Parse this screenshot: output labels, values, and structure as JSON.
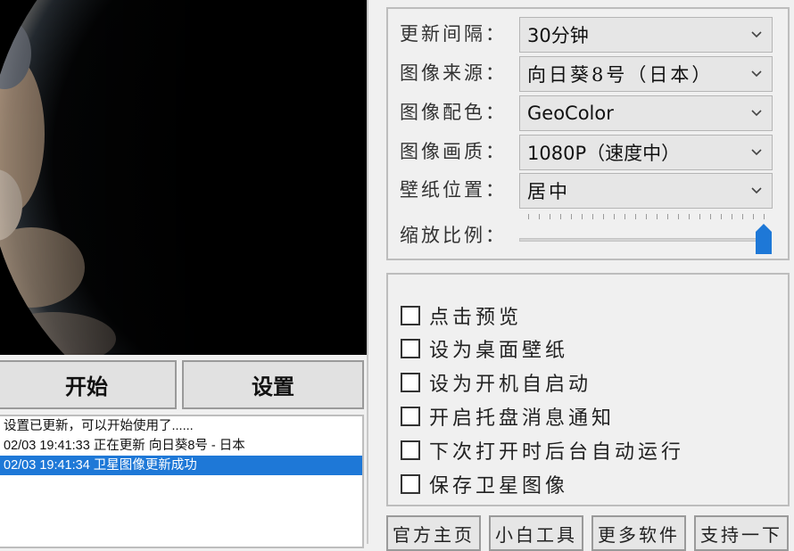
{
  "preview": {
    "icon": "earth-satellite-image"
  },
  "actions": {
    "start_label": "开始",
    "settings_label": "设置"
  },
  "log": {
    "lines": [
      "设置已更新，可以开始使用了......",
      "02/03 19:41:33 正在更新 向日葵8号 - 日本",
      "02/03 19:41:34 卫星图像更新成功"
    ],
    "selected_index": 2
  },
  "settings": {
    "update_interval": {
      "label": "更新间隔：",
      "value": "30分钟"
    },
    "image_source": {
      "label": "图像来源：",
      "value": "向日葵8号（日本）"
    },
    "color_scheme": {
      "label": "图像配色：",
      "value": "GeoColor"
    },
    "image_quality": {
      "label": "图像画质：",
      "value": "1080P（速度中）"
    },
    "wallpaper_position": {
      "label": "壁纸位置：",
      "value": "居中"
    },
    "zoom": {
      "label": "缩放比例：",
      "level": 1.0
    }
  },
  "options": [
    {
      "label": "点击预览",
      "checked": false
    },
    {
      "label": "设为桌面壁纸",
      "checked": false
    },
    {
      "label": "设为开机自启动",
      "checked": false
    },
    {
      "label": "开启托盘消息通知",
      "checked": false
    },
    {
      "label": "下次打开时后台自动运行",
      "checked": false
    },
    {
      "label": "保存卫星图像",
      "checked": false
    }
  ],
  "links": {
    "homepage": "官方主页",
    "tools": "小白工具",
    "more_software": "更多软件",
    "support": "支持一下"
  },
  "colors": {
    "accent": "#1e78d7",
    "slider_thumb": "#1e78d7"
  }
}
